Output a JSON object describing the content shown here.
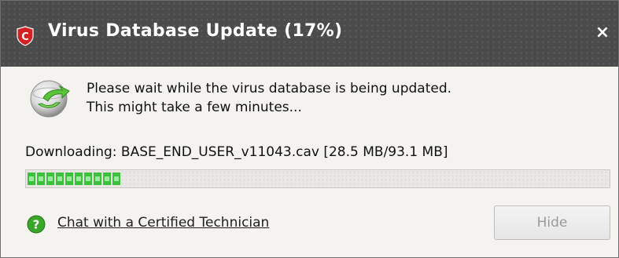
{
  "window": {
    "title": "Virus Database Update (17%)",
    "close_glyph": "×",
    "icons": {
      "app": "comodo-shield-icon",
      "close": "close-icon"
    }
  },
  "message": {
    "line1": "Please wait while the virus database is being updated.",
    "line2": "This might take a few minutes...",
    "icon": "database-update-icon"
  },
  "download": {
    "label": "Downloading: BASE_END_USER_v11043.cav [28.5 MB/93.1 MB]",
    "progress_fraction": 0.17
  },
  "help": {
    "link_text": "Chat with a Certified Technician",
    "icon": "help-icon"
  },
  "buttons": {
    "hide_label": "Hide",
    "hide_enabled": false
  },
  "colors": {
    "titlebar": "#4b4b4b",
    "progress_green": "#3ac23a",
    "brand_red": "#d32020"
  }
}
